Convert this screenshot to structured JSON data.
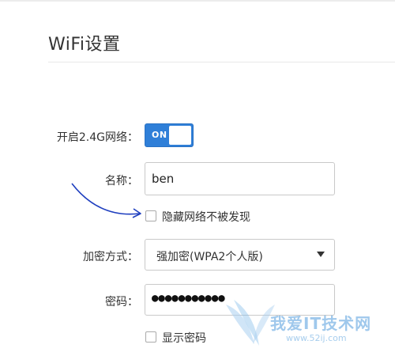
{
  "header": {
    "title": "WiFi设置"
  },
  "form": {
    "enable_label": "开启2.4G网络：",
    "toggle_text": "ON",
    "toggle_state": "on",
    "name_label": "名称：",
    "name_value": "ben",
    "hide_label": "隐藏网络不被发现",
    "hide_checked": false,
    "encryption_label": "加密方式：",
    "encryption_value": "强加密(WPA2个人版)",
    "password_label": "密码：",
    "password_masked": "●●●●●●●●●●●",
    "show_password_label": "显示密码",
    "show_password_checked": false
  },
  "annotation": {
    "arrow_color": "#1f3fbf"
  },
  "watermark": {
    "text": "我爱IT技术网",
    "url": "www.52ij.com"
  },
  "colors": {
    "toggle_on": "#2f7fd8",
    "border": "#c9c9c9",
    "divider": "#e8e8e8"
  }
}
